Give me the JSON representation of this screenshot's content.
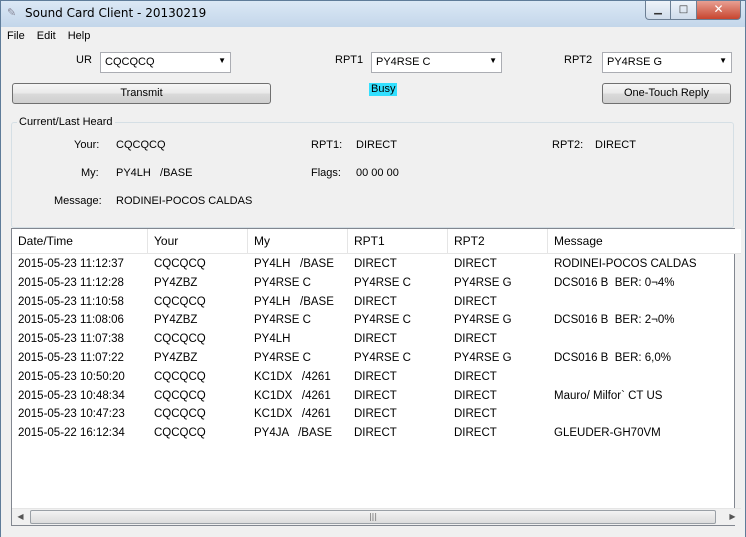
{
  "window": {
    "title": "Sound Card Client - 20130219",
    "icon": "feather-icon"
  },
  "menu": {
    "file": "File",
    "edit": "Edit",
    "help": "Help"
  },
  "controls": {
    "ur_label": "UR",
    "ur_value": "CQCQCQ",
    "rpt1_label": "RPT1",
    "rpt1_value": "PY4RSE C",
    "rpt2_label": "RPT2",
    "rpt2_value": "PY4RSE G",
    "transmit_label": "Transmit",
    "status": "Busy",
    "status_color": "#33e0ff",
    "one_touch_label": "One-Touch Reply"
  },
  "heard": {
    "group_title": "Current/Last Heard",
    "your_label": "Your:",
    "your_value": "CQCQCQ",
    "rpt1_label": "RPT1:",
    "rpt1_value": "DIRECT",
    "rpt2_label": "RPT2:",
    "rpt2_value": "DIRECT",
    "my_label": "My:",
    "my_value": "PY4LH   /BASE",
    "flags_label": "Flags:",
    "flags_value": "00 00 00",
    "message_label": "Message:",
    "message_value": "RODINEI-POCOS CALDAS"
  },
  "table": {
    "columns": [
      "Date/Time",
      "Your",
      "My",
      "RPT1",
      "RPT2",
      "Message"
    ],
    "rows": [
      [
        "2015-05-23 11:12:37",
        "CQCQCQ",
        "PY4LH   /BASE",
        "DIRECT",
        "DIRECT",
        "RODINEI-POCOS CALDAS"
      ],
      [
        "2015-05-23 11:12:28",
        "PY4ZBZ",
        "PY4RSE C",
        "PY4RSE C",
        "PY4RSE G",
        "DCS016 B  BER: 0¬4%"
      ],
      [
        "2015-05-23 11:10:58",
        "CQCQCQ",
        "PY4LH   /BASE",
        "DIRECT",
        "DIRECT",
        ""
      ],
      [
        "2015-05-23 11:08:06",
        "PY4ZBZ",
        "PY4RSE C",
        "PY4RSE C",
        "PY4RSE G",
        "DCS016 B  BER: 2¬0%"
      ],
      [
        "2015-05-23 11:07:38",
        "CQCQCQ",
        "PY4LH",
        "DIRECT",
        "DIRECT",
        ""
      ],
      [
        "2015-05-23 11:07:22",
        "PY4ZBZ",
        "PY4RSE C",
        "PY4RSE C",
        "PY4RSE G",
        "DCS016 B  BER: 6,0%"
      ],
      [
        "2015-05-23 10:50:20",
        "CQCQCQ",
        "KC1DX   /4261",
        "DIRECT",
        "DIRECT",
        ""
      ],
      [
        "2015-05-23 10:48:34",
        "CQCQCQ",
        "KC1DX   /4261",
        "DIRECT",
        "DIRECT",
        "Mauro/ Milfor` CT US"
      ],
      [
        "2015-05-23 10:47:23",
        "CQCQCQ",
        "KC1DX   /4261",
        "DIRECT",
        "DIRECT",
        ""
      ],
      [
        "2015-05-22 16:12:34",
        "CQCQCQ",
        "PY4JA   /BASE",
        "DIRECT",
        "DIRECT",
        "GLEUDER-GH70VM"
      ]
    ]
  }
}
